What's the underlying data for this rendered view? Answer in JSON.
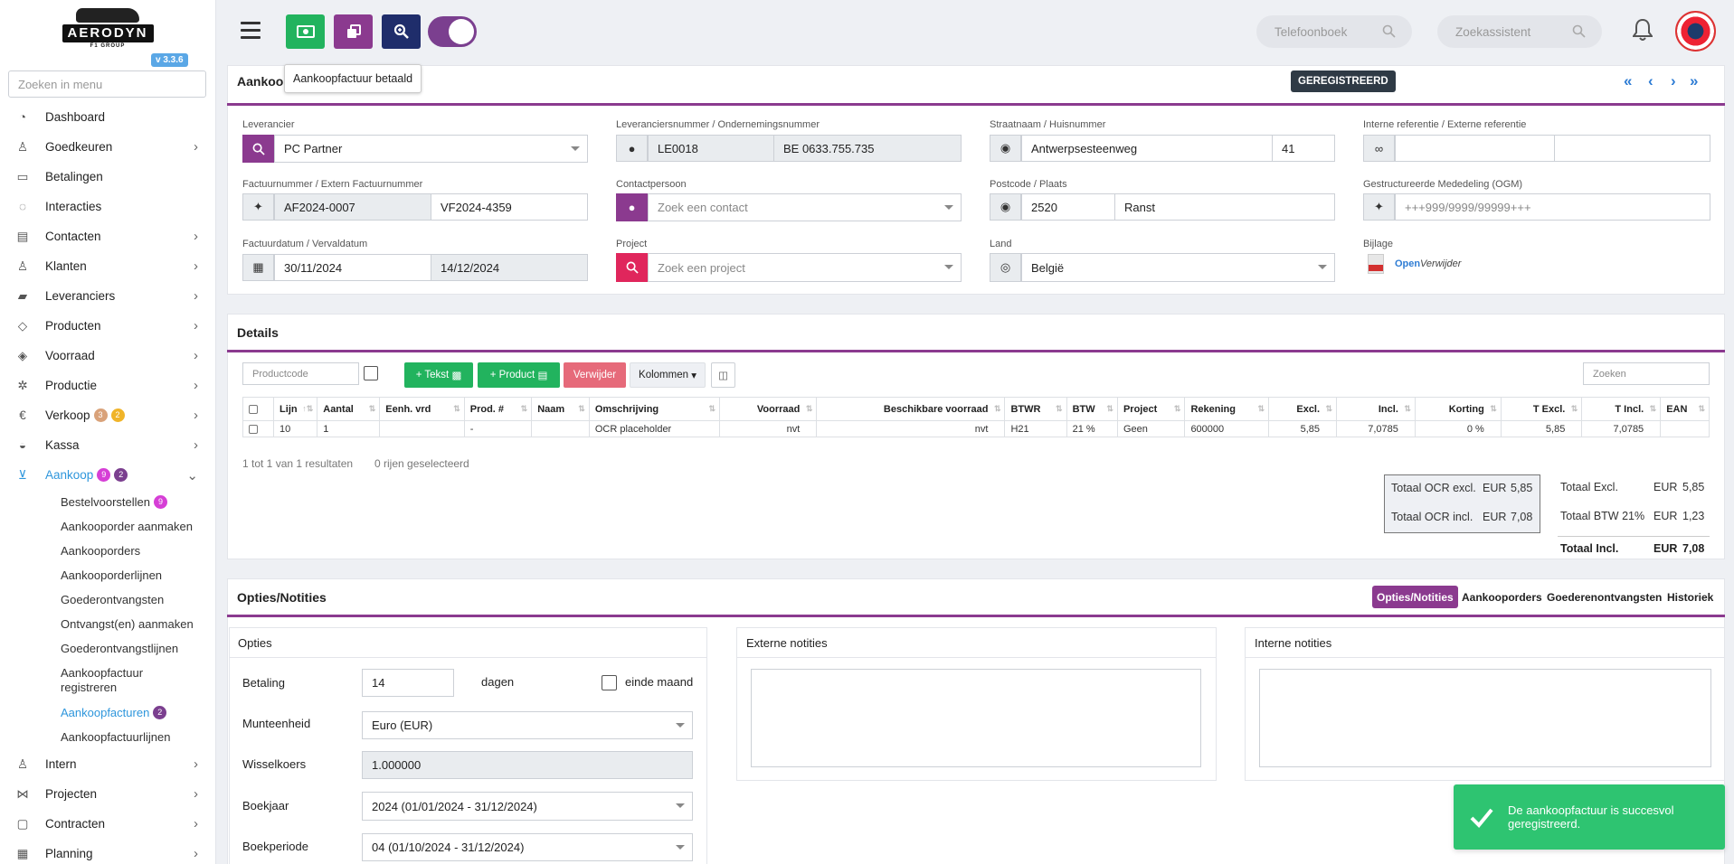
{
  "app": {
    "logo_text": "AERODYN",
    "logo_sub": "F1 GROUP",
    "version": "v 3.3.6",
    "menu_search_placeholder": "Zoeken in menu"
  },
  "sidebar": {
    "items": [
      {
        "label": "Dashboard",
        "icon": "gauge-icon",
        "chev": false
      },
      {
        "label": "Goedkeuren",
        "icon": "user-check-icon",
        "chev": true
      },
      {
        "label": "Betalingen",
        "icon": "cash-icon",
        "chev": false
      },
      {
        "label": "Interacties",
        "icon": "chat-icon",
        "chev": false
      },
      {
        "label": "Contacten",
        "icon": "id-card-icon",
        "chev": true
      },
      {
        "label": "Klanten",
        "icon": "user-icon",
        "chev": true
      },
      {
        "label": "Leveranciers",
        "icon": "truck-icon",
        "chev": true
      },
      {
        "label": "Producten",
        "icon": "box-icon",
        "chev": true
      },
      {
        "label": "Voorraad",
        "icon": "boxes-icon",
        "chev": true
      },
      {
        "label": "Productie",
        "icon": "gears-icon",
        "chev": true
      },
      {
        "label": "Verkoop",
        "icon": "euro-icon",
        "chev": true,
        "badges": [
          {
            "v": "3",
            "c": "#d9a27a"
          },
          {
            "v": "2",
            "c": "#f0b429"
          }
        ]
      },
      {
        "label": "Kassa",
        "icon": "basket-icon",
        "chev": true
      },
      {
        "label": "Aankoop",
        "icon": "cart-icon",
        "chev": true,
        "active": true,
        "badges": [
          {
            "v": "9",
            "c": "#d63fd6"
          },
          {
            "v": "2",
            "c": "#7b3f8f"
          }
        ]
      }
    ],
    "sub_items": [
      {
        "label": "Bestelvoorstellen",
        "badge": "9"
      },
      {
        "label": "Aankooporder aanmaken"
      },
      {
        "label": "Aankooporders"
      },
      {
        "label": "Aankooporderlijnen"
      },
      {
        "label": "Goederontvangsten"
      },
      {
        "label": "Ontvangst(en) aanmaken"
      },
      {
        "label": "Goederontvangstlijnen"
      },
      {
        "label": "Aankoopfactuur registreren"
      },
      {
        "label": "Aankoopfacturen",
        "badge": "2",
        "active": true
      },
      {
        "label": "Aankoopfactuurlijnen"
      }
    ],
    "items_after": [
      {
        "label": "Intern",
        "icon": "users-icon"
      },
      {
        "label": "Projecten",
        "icon": "project-icon"
      },
      {
        "label": "Contracten",
        "icon": "contract-icon"
      },
      {
        "label": "Planning",
        "icon": "calendar-icon"
      }
    ]
  },
  "topbar": {
    "tooltip": "Aankoopfactuur betaald",
    "phonebook_placeholder": "Telefoonboek",
    "assistant_placeholder": "Zoekassistent"
  },
  "header": {
    "title": "Aankoop",
    "status": "GEREGISTREERD",
    "fields": {
      "leverancier_label": "Leverancier",
      "leverancier": "PC Partner",
      "levnr_label": "Leveranciersnummer / Ondernemingsnummer",
      "levnr": "LE0018",
      "ondnr": "BE 0633.755.735",
      "straat_label": "Straatnaam / Huisnummer",
      "straat": "Antwerpsesteenweg",
      "huisnr": "41",
      "ref_label": "Interne referentie / Externe referentie",
      "int_ref": "",
      "ext_ref": "",
      "factnr_label": "Factuurnummer / Extern Factuurnummer",
      "factnr": "AF2024-0007",
      "ext_factnr": "VF2024-4359",
      "contact_label": "Contactpersoon",
      "contact_placeholder": "Zoek een contact",
      "postcode_label": "Postcode / Plaats",
      "postcode": "2520",
      "plaats": "Ranst",
      "ogm_label": "Gestructureerde Mededeling (OGM)",
      "ogm_placeholder": "+++999/9999/99999+++",
      "datum_label": "Factuurdatum / Vervaldatum",
      "factdatum": "30/11/2024",
      "vervaldatum": "14/12/2024",
      "project_label": "Project",
      "project_placeholder": "Zoek een project",
      "land_label": "Land",
      "land": "België",
      "bijlage_label": "Bijlage",
      "open": "Open",
      "verwijder": "Verwijder"
    }
  },
  "details": {
    "title": "Details",
    "productcode_placeholder": "Productcode",
    "btn_tekst": "+ Tekst",
    "btn_product": "+ Product",
    "btn_verwijder": "Verwijder",
    "btn_kolommen": "Kolommen",
    "search_placeholder": "Zoeken",
    "columns": [
      "Lijn",
      "Aantal",
      "Eenh. vrd",
      "Prod. #",
      "Naam",
      "Omschrijving",
      "Voorraad",
      "Beschikbare voorraad",
      "BTWR",
      "BTW",
      "Project",
      "Rekening",
      "Excl.",
      "Incl.",
      "Korting",
      "T Excl.",
      "T Incl.",
      "EAN"
    ],
    "rows": [
      [
        "10",
        "1",
        "",
        "-",
        "",
        "OCR placeholder",
        "nvt",
        "nvt",
        "H21",
        "21 %",
        "Geen",
        "600000",
        "5,85",
        "7,0785",
        "0 %",
        "5,85",
        "7,0785",
        ""
      ]
    ],
    "pager": "1 tot 1 van 1 resultaten",
    "selected": "0 rijen geselecteerd",
    "totals_ocr": [
      {
        "label": "Totaal OCR excl.",
        "cur": "EUR",
        "val": "5,85"
      },
      {
        "label": "Totaal OCR incl.",
        "cur": "EUR",
        "val": "7,08"
      }
    ],
    "totals": [
      {
        "label": "Totaal Excl.",
        "cur": "EUR",
        "val": "5,85"
      },
      {
        "label": "Totaal BTW 21%",
        "cur": "EUR",
        "val": "1,23"
      },
      {
        "label": "Totaal Incl.",
        "cur": "EUR",
        "val": "7,08"
      }
    ]
  },
  "options": {
    "title": "Opties/Notities",
    "tabs": [
      "Opties/Notities",
      "Aankooporders",
      "Goederenontvangsten",
      "Historiek"
    ],
    "opties_title": "Opties",
    "ext_title": "Externe notities",
    "int_title": "Interne notities",
    "betaling_label": "Betaling",
    "betaling": "14",
    "dagen": "dagen",
    "einde_maand": "einde maand",
    "munt_label": "Munteenheid",
    "munt": "Euro (EUR)",
    "koers_label": "Wisselkoers",
    "koers": "1.000000",
    "boekjaar_label": "Boekjaar",
    "boekjaar": "2024 (01/01/2024 - 31/12/2024)",
    "boekperiode_label": "Boekperiode",
    "boekperiode": "04 (01/10/2024 - 31/12/2024)"
  },
  "toast": {
    "line1": "De aankoopfactuur is succesvol",
    "line2": "geregistreerd."
  }
}
